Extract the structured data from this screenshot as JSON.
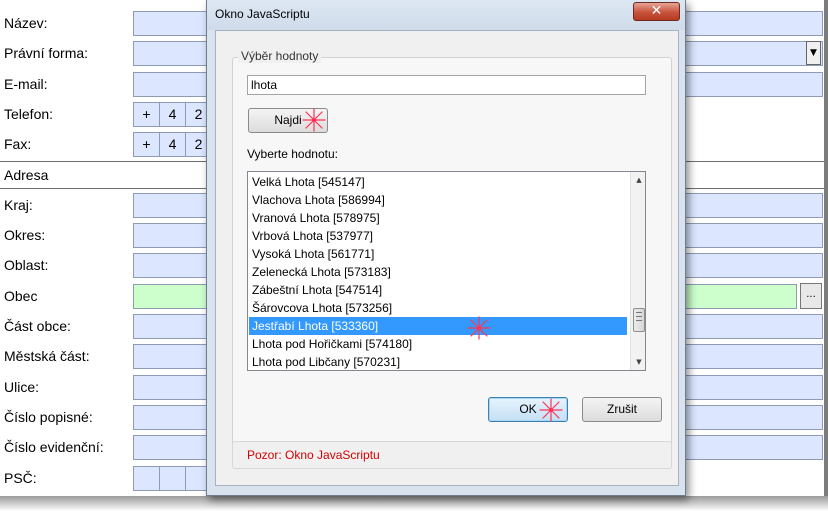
{
  "form": {
    "fields": [
      {
        "label": "Název:",
        "type": "field"
      },
      {
        "label": "Právní forma:",
        "type": "select"
      },
      {
        "label": "E-mail:",
        "type": "field"
      },
      {
        "label": "Telefon:",
        "type": "phone",
        "cells": [
          "+",
          "4",
          "2"
        ]
      },
      {
        "label": "Fax:",
        "type": "phone",
        "cells": [
          "+",
          "4",
          "2"
        ]
      },
      {
        "label": "Adresa",
        "type": "section"
      },
      {
        "label": "Kraj:",
        "type": "field"
      },
      {
        "label": "Okres:",
        "type": "field"
      },
      {
        "label": "Oblast:",
        "type": "field"
      },
      {
        "label": "Obec",
        "type": "highlight"
      },
      {
        "label": "Část obce:",
        "type": "field"
      },
      {
        "label": "Městská část:",
        "type": "field"
      },
      {
        "label": "Ulice:",
        "type": "field"
      },
      {
        "label": "Číslo popisné:",
        "type": "field"
      },
      {
        "label": "Číslo evidenční:",
        "type": "field"
      },
      {
        "label": "PSČ:",
        "type": "cells"
      }
    ],
    "dropdown_icon": "chevron-down-icon",
    "obec_button_label": "..."
  },
  "dialog": {
    "title": "Okno JavaScriptu",
    "close_label": "✕",
    "group_title": "Výběr hodnoty",
    "search_value": "lhota",
    "find_label": "Najdi",
    "list_label": "Vyberte hodnotu:",
    "items": [
      "Velká Lhota [545147]",
      "Vlachova Lhota [586994]",
      "Vranová Lhota [578975]",
      "Vrbová Lhota [537977]",
      "Vysoká Lhota [561771]",
      "Zelenecká Lhota [573183]",
      "Zábeštní Lhota [547514]",
      "Šárovcova Lhota [573256]",
      "Jestřabí Lhota [533360]",
      "Lhota pod Hořičkami [574180]",
      "Lhota pod Libčany [570231]"
    ],
    "selected_index": 8,
    "ok_label": "OK",
    "cancel_label": "Zrušit",
    "warning": "Pozor: Okno JavaScriptu",
    "warning_color": "#d40000",
    "selection_color": "#3399ff"
  }
}
